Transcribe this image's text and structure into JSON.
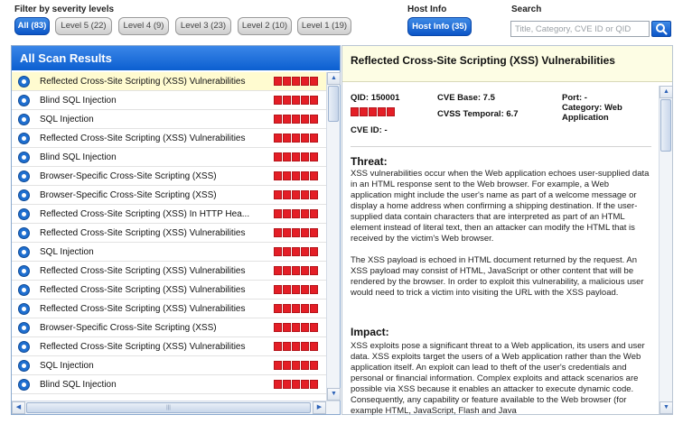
{
  "filters": {
    "label": "Filter by severity levels",
    "buttons": [
      {
        "label": "All (83)",
        "active": true
      },
      {
        "label": "Level 5 (22)",
        "active": false
      },
      {
        "label": "Level 4 (9)",
        "active": false
      },
      {
        "label": "Level 3 (23)",
        "active": false
      },
      {
        "label": "Level 2 (10)",
        "active": false
      },
      {
        "label": "Level 1 (19)",
        "active": false
      }
    ]
  },
  "host_info": {
    "label": "Host Info",
    "button": "Host Info (35)"
  },
  "search": {
    "label": "Search",
    "placeholder": "Title, Category, CVE ID or QID",
    "icon": "search-icon"
  },
  "results": {
    "title": "All Scan Results",
    "items": [
      {
        "title": "Reflected Cross-Site Scripting (XSS) Vulnerabilities",
        "severity": 5,
        "selected": true
      },
      {
        "title": "Blind SQL Injection",
        "severity": 5,
        "selected": false
      },
      {
        "title": "SQL Injection",
        "severity": 5,
        "selected": false
      },
      {
        "title": "Reflected Cross-Site Scripting (XSS) Vulnerabilities",
        "severity": 5,
        "selected": false
      },
      {
        "title": "Blind SQL Injection",
        "severity": 5,
        "selected": false
      },
      {
        "title": "Browser-Specific Cross-Site Scripting (XSS)",
        "severity": 5,
        "selected": false
      },
      {
        "title": "Browser-Specific Cross-Site Scripting (XSS)",
        "severity": 5,
        "selected": false
      },
      {
        "title": "Reflected Cross-Site Scripting (XSS) In HTTP Hea...",
        "severity": 5,
        "selected": false
      },
      {
        "title": "Reflected Cross-Site Scripting (XSS) Vulnerabilities",
        "severity": 5,
        "selected": false
      },
      {
        "title": "SQL Injection",
        "severity": 5,
        "selected": false
      },
      {
        "title": "Reflected Cross-Site Scripting (XSS) Vulnerabilities",
        "severity": 5,
        "selected": false
      },
      {
        "title": "Reflected Cross-Site Scripting (XSS) Vulnerabilities",
        "severity": 5,
        "selected": false
      },
      {
        "title": "Reflected Cross-Site Scripting (XSS) Vulnerabilities",
        "severity": 5,
        "selected": false
      },
      {
        "title": "Browser-Specific Cross-Site Scripting (XSS)",
        "severity": 5,
        "selected": false
      },
      {
        "title": "Reflected Cross-Site Scripting (XSS) Vulnerabilities",
        "severity": 5,
        "selected": false
      },
      {
        "title": "SQL Injection",
        "severity": 5,
        "selected": false
      },
      {
        "title": "Blind SQL Injection",
        "severity": 5,
        "selected": false
      }
    ],
    "scroll_grip": "|||"
  },
  "detail": {
    "title": "Reflected Cross-Site Scripting (XSS) Vulnerabilities",
    "qid": "QID: 150001",
    "severity": 5,
    "cve_id": "CVE ID: -",
    "cve_base": "CVE Base: 7.5",
    "cvss_temporal": "CVSS Temporal: 6.7",
    "port": "Port: -",
    "category": "Category: Web Application",
    "threat_title": "Threat:",
    "threat_p1": "XSS vulnerabilities occur when the Web application echoes user-supplied data in an HTML response sent to the Web browser. For example, a Web application might include the user's name as part of a welcome message or display a home address when confirming a shipping destination. If the user-supplied data contain characters that are interpreted as part of an HTML element instead of literal text, then an attacker can modify the HTML that is received by the victim's Web browser.",
    "threat_p2": "The XSS payload is echoed in HTML document returned by the request. An XSS payload may consist of HTML, JavaScript or other content that will be rendered by the browser. In order to exploit this vulnerability, a malicious user would need to trick a victim into visiting the URL with the XSS payload.",
    "impact_title": "Impact:",
    "impact_p1": "XSS exploits pose a significant threat to a Web application, its users and user data. XSS exploits target the users of a Web application rather than the Web application itself. An exploit can lead to theft of the user's credentials and personal or financial information. Complex exploits and attack scenarios are possible via XSS because it enables an attacker to execute dynamic code. Consequently, any capability or feature available to the Web browser (for example HTML, JavaScript, Flash and Java"
  },
  "colors": {
    "accent": "#0c5fd0",
    "severity": "#e41e26",
    "selected_row": "#fffbd0",
    "detail_header": "#fdfde4"
  }
}
